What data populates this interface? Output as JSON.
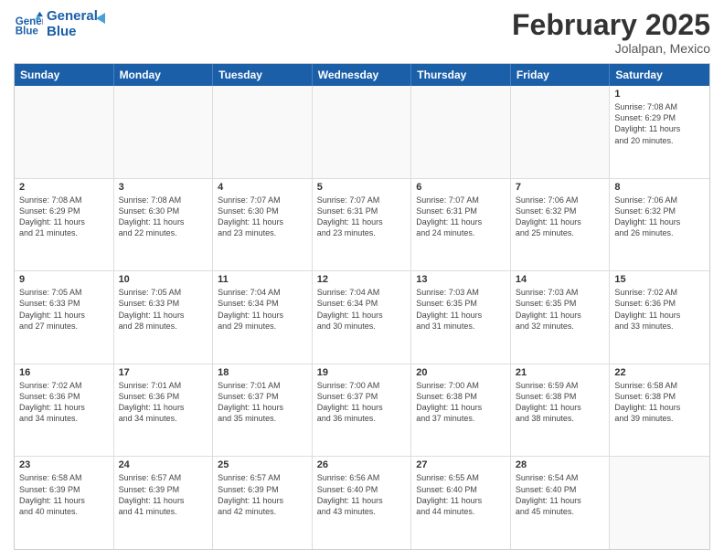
{
  "logo": {
    "line1": "General",
    "line2": "Blue"
  },
  "title": "February 2025",
  "location": "Jolalpan, Mexico",
  "days_of_week": [
    "Sunday",
    "Monday",
    "Tuesday",
    "Wednesday",
    "Thursday",
    "Friday",
    "Saturday"
  ],
  "weeks": [
    [
      {
        "day": "",
        "info": ""
      },
      {
        "day": "",
        "info": ""
      },
      {
        "day": "",
        "info": ""
      },
      {
        "day": "",
        "info": ""
      },
      {
        "day": "",
        "info": ""
      },
      {
        "day": "",
        "info": ""
      },
      {
        "day": "1",
        "info": "Sunrise: 7:08 AM\nSunset: 6:29 PM\nDaylight: 11 hours\nand 20 minutes."
      }
    ],
    [
      {
        "day": "2",
        "info": "Sunrise: 7:08 AM\nSunset: 6:29 PM\nDaylight: 11 hours\nand 21 minutes."
      },
      {
        "day": "3",
        "info": "Sunrise: 7:08 AM\nSunset: 6:30 PM\nDaylight: 11 hours\nand 22 minutes."
      },
      {
        "day": "4",
        "info": "Sunrise: 7:07 AM\nSunset: 6:30 PM\nDaylight: 11 hours\nand 23 minutes."
      },
      {
        "day": "5",
        "info": "Sunrise: 7:07 AM\nSunset: 6:31 PM\nDaylight: 11 hours\nand 23 minutes."
      },
      {
        "day": "6",
        "info": "Sunrise: 7:07 AM\nSunset: 6:31 PM\nDaylight: 11 hours\nand 24 minutes."
      },
      {
        "day": "7",
        "info": "Sunrise: 7:06 AM\nSunset: 6:32 PM\nDaylight: 11 hours\nand 25 minutes."
      },
      {
        "day": "8",
        "info": "Sunrise: 7:06 AM\nSunset: 6:32 PM\nDaylight: 11 hours\nand 26 minutes."
      }
    ],
    [
      {
        "day": "9",
        "info": "Sunrise: 7:05 AM\nSunset: 6:33 PM\nDaylight: 11 hours\nand 27 minutes."
      },
      {
        "day": "10",
        "info": "Sunrise: 7:05 AM\nSunset: 6:33 PM\nDaylight: 11 hours\nand 28 minutes."
      },
      {
        "day": "11",
        "info": "Sunrise: 7:04 AM\nSunset: 6:34 PM\nDaylight: 11 hours\nand 29 minutes."
      },
      {
        "day": "12",
        "info": "Sunrise: 7:04 AM\nSunset: 6:34 PM\nDaylight: 11 hours\nand 30 minutes."
      },
      {
        "day": "13",
        "info": "Sunrise: 7:03 AM\nSunset: 6:35 PM\nDaylight: 11 hours\nand 31 minutes."
      },
      {
        "day": "14",
        "info": "Sunrise: 7:03 AM\nSunset: 6:35 PM\nDaylight: 11 hours\nand 32 minutes."
      },
      {
        "day": "15",
        "info": "Sunrise: 7:02 AM\nSunset: 6:36 PM\nDaylight: 11 hours\nand 33 minutes."
      }
    ],
    [
      {
        "day": "16",
        "info": "Sunrise: 7:02 AM\nSunset: 6:36 PM\nDaylight: 11 hours\nand 34 minutes."
      },
      {
        "day": "17",
        "info": "Sunrise: 7:01 AM\nSunset: 6:36 PM\nDaylight: 11 hours\nand 34 minutes."
      },
      {
        "day": "18",
        "info": "Sunrise: 7:01 AM\nSunset: 6:37 PM\nDaylight: 11 hours\nand 35 minutes."
      },
      {
        "day": "19",
        "info": "Sunrise: 7:00 AM\nSunset: 6:37 PM\nDaylight: 11 hours\nand 36 minutes."
      },
      {
        "day": "20",
        "info": "Sunrise: 7:00 AM\nSunset: 6:38 PM\nDaylight: 11 hours\nand 37 minutes."
      },
      {
        "day": "21",
        "info": "Sunrise: 6:59 AM\nSunset: 6:38 PM\nDaylight: 11 hours\nand 38 minutes."
      },
      {
        "day": "22",
        "info": "Sunrise: 6:58 AM\nSunset: 6:38 PM\nDaylight: 11 hours\nand 39 minutes."
      }
    ],
    [
      {
        "day": "23",
        "info": "Sunrise: 6:58 AM\nSunset: 6:39 PM\nDaylight: 11 hours\nand 40 minutes."
      },
      {
        "day": "24",
        "info": "Sunrise: 6:57 AM\nSunset: 6:39 PM\nDaylight: 11 hours\nand 41 minutes."
      },
      {
        "day": "25",
        "info": "Sunrise: 6:57 AM\nSunset: 6:39 PM\nDaylight: 11 hours\nand 42 minutes."
      },
      {
        "day": "26",
        "info": "Sunrise: 6:56 AM\nSunset: 6:40 PM\nDaylight: 11 hours\nand 43 minutes."
      },
      {
        "day": "27",
        "info": "Sunrise: 6:55 AM\nSunset: 6:40 PM\nDaylight: 11 hours\nand 44 minutes."
      },
      {
        "day": "28",
        "info": "Sunrise: 6:54 AM\nSunset: 6:40 PM\nDaylight: 11 hours\nand 45 minutes."
      },
      {
        "day": "",
        "info": ""
      }
    ]
  ]
}
